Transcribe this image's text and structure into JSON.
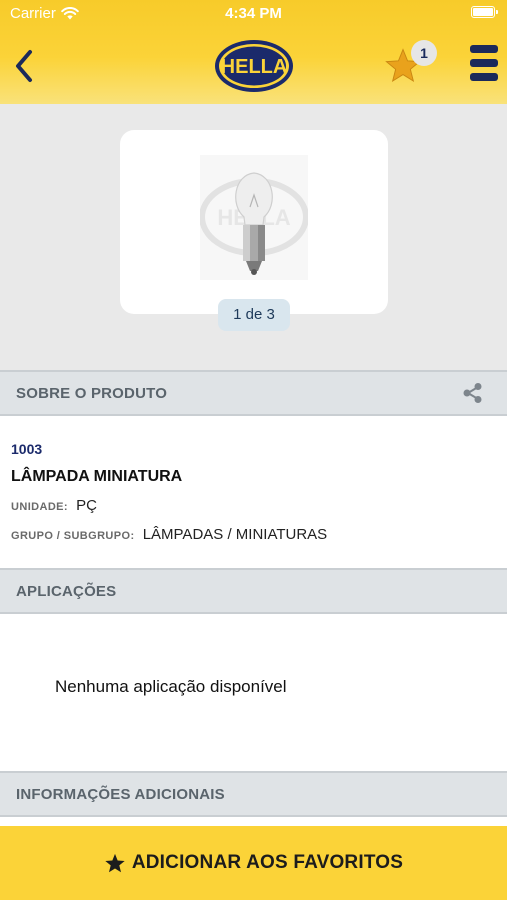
{
  "status_bar": {
    "carrier": "Carrier",
    "time": "4:34 PM"
  },
  "header": {
    "logo_text": "HELLA",
    "favorites_count": "1",
    "colors": {
      "bar": "#fbd338",
      "navy": "#1b2a5a",
      "star": "#e9a21c"
    }
  },
  "gallery": {
    "counter": "1 de 3",
    "image_watermark": "HELLA"
  },
  "section_about": {
    "title": "SOBRE O PRODUTO"
  },
  "product": {
    "code": "1003",
    "name": "LÂMPADA MINIATURA",
    "unit_label": "UNIDADE:",
    "unit_value": "PÇ",
    "group_label": "GRUPO / SUBGRUPO:",
    "group_value": "LÂMPADAS / MINIATURAS"
  },
  "section_apps": {
    "title": "APLICAÇÕES",
    "empty_text": "Nenhuma aplicação disponível"
  },
  "section_extra": {
    "title": "INFORMAÇÕES ADICIONAIS"
  },
  "bottom_button": {
    "label": "ADICIONAR AOS FAVORITOS"
  }
}
